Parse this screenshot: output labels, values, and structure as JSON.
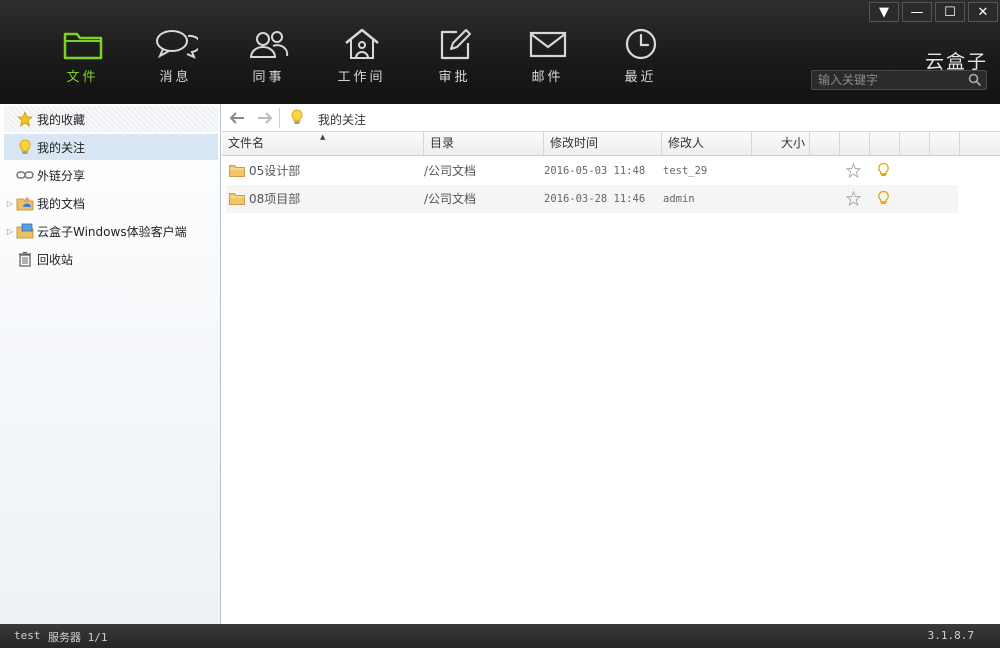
{
  "window_controls": {
    "menu": "▼",
    "minimize": "—",
    "maximize": "☐",
    "close": "✕"
  },
  "nav": [
    {
      "id": "files",
      "label": "文件",
      "icon": "folder-icon",
      "active": true
    },
    {
      "id": "messages",
      "label": "消息",
      "icon": "chat-bubbles-icon"
    },
    {
      "id": "colleagues",
      "label": "同事",
      "icon": "people-icon"
    },
    {
      "id": "workspace",
      "label": "工作间",
      "icon": "house-icon"
    },
    {
      "id": "approval",
      "label": "审批",
      "icon": "edit-icon"
    },
    {
      "id": "mail",
      "label": "邮件",
      "icon": "envelope-icon"
    },
    {
      "id": "recent",
      "label": "最近",
      "icon": "clock-icon"
    }
  ],
  "brand": "云盒子",
  "search": {
    "placeholder": "输入关键字"
  },
  "sidebar": {
    "items": [
      {
        "label": "我的收藏",
        "icon": "star-icon"
      },
      {
        "label": "我的关注",
        "icon": "lightbulb-icon"
      },
      {
        "label": "外链分享",
        "icon": "link-icon"
      },
      {
        "label": "我的文档",
        "icon": "user-folder-icon"
      },
      {
        "label": "云盒子Windows体验客户端",
        "icon": "computer-folder-icon"
      },
      {
        "label": "回收站",
        "icon": "trash-icon"
      }
    ]
  },
  "toolbar": {
    "breadcrumb": "我的关注"
  },
  "columns": [
    "文件名",
    "目录",
    "修改时间",
    "修改人",
    "大小"
  ],
  "rows": [
    {
      "name": "05设计部",
      "dir": "/公司文档",
      "modified": "2016-05-03 11:48",
      "modifier": "test_29"
    },
    {
      "name": "08项目部",
      "dir": "/公司文档",
      "modified": "2016-03-28 11:46",
      "modifier": "admin"
    }
  ],
  "status": {
    "user": "test",
    "server": "服务器 1/1",
    "version": "3.1.8.7"
  },
  "colors": {
    "accent": "#7ed321",
    "topbar": "#1b1b1b",
    "selected": "#d9e6f3"
  }
}
